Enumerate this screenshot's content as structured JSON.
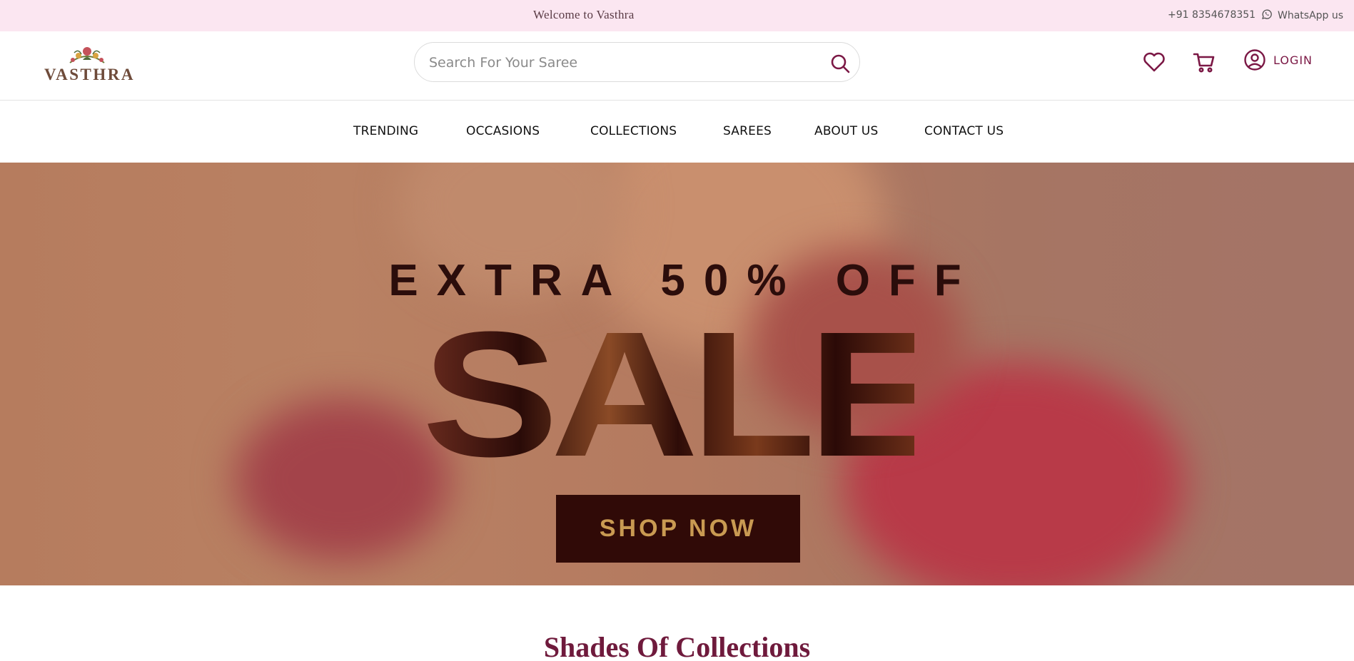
{
  "topbar": {
    "welcome": "Welcome to Vasthra",
    "phone": "+91 8354678351",
    "whatsapp_label": "WhatsApp us"
  },
  "header": {
    "logo_text": "VASTHRA",
    "search_placeholder": "Search For Your Saree",
    "login_label": "LOGIN",
    "icons": [
      "heart-icon",
      "cart-icon",
      "user-icon",
      "search-icon",
      "whatsapp-icon"
    ]
  },
  "nav": {
    "items": [
      "TRENDING",
      "OCCASIONS",
      "COLLECTIONS",
      "SAREES",
      "ABOUT US",
      "CONTACT US"
    ]
  },
  "hero": {
    "headline": "EXTRA 50% OFF",
    "sale_word": "SALE",
    "cta_label": "SHOP NOW"
  },
  "sections": {
    "collections_title": "Shades Of Collections"
  },
  "colors": {
    "topbar_bg": "#fbe6f1",
    "brand_maroon": "#7b1845",
    "cta_bg": "#300a07",
    "cta_text": "#c99a52"
  }
}
